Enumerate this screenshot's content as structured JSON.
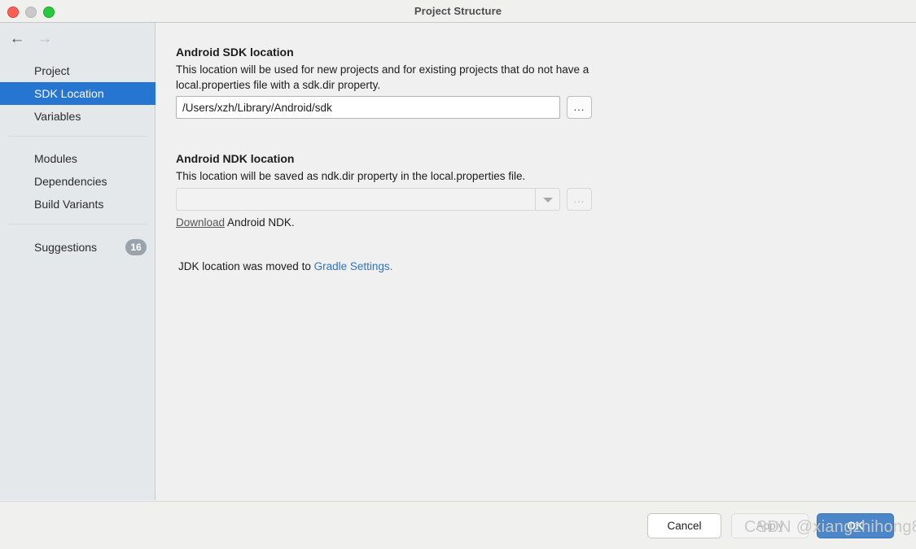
{
  "window": {
    "title": "Project Structure",
    "traffic_lights": [
      "close",
      "minimize",
      "maximize"
    ]
  },
  "sidebar": {
    "nav": {
      "back_icon": "arrow-left-icon",
      "forward_icon": "arrow-right-icon",
      "back_enabled": true,
      "forward_enabled": false
    },
    "group1": [
      {
        "label": "Project",
        "selected": false
      },
      {
        "label": "SDK Location",
        "selected": true
      },
      {
        "label": "Variables",
        "selected": false
      }
    ],
    "group2": [
      {
        "label": "Modules",
        "selected": false
      },
      {
        "label": "Dependencies",
        "selected": false
      },
      {
        "label": "Build Variants",
        "selected": false
      }
    ],
    "suggestions": {
      "label": "Suggestions",
      "badge": "16"
    },
    "selection_color": "#2675d0",
    "background_color": "#e4e8eb"
  },
  "main": {
    "sdk": {
      "title": "Android SDK location",
      "description": "This location will be used for new projects and for existing projects that do not have a local.properties file with a sdk.dir property.",
      "path_value": "/Users/xzh/Library/Android/sdk",
      "path_placeholder": "",
      "browse_label": "..."
    },
    "ndk": {
      "title": "Android NDK location",
      "description": "This location will be saved as ndk.dir property in the local.properties file.",
      "path_value": "",
      "path_placeholder": "",
      "browse_label": "...",
      "dropdown_icon": "chevron-down-icon",
      "download_link": "Download",
      "download_rest": " Android NDK."
    },
    "jdk": {
      "prefix": "JDK location was moved to ",
      "link": "Gradle Settings.",
      "link_color": "#2f74c0"
    }
  },
  "footer": {
    "cancel_label": "Cancel",
    "apply_label": "Apply",
    "ok_label": "OK",
    "ok_color": "#4a86c8"
  },
  "watermark": {
    "text": "CSDN @xiangzhihong8"
  }
}
